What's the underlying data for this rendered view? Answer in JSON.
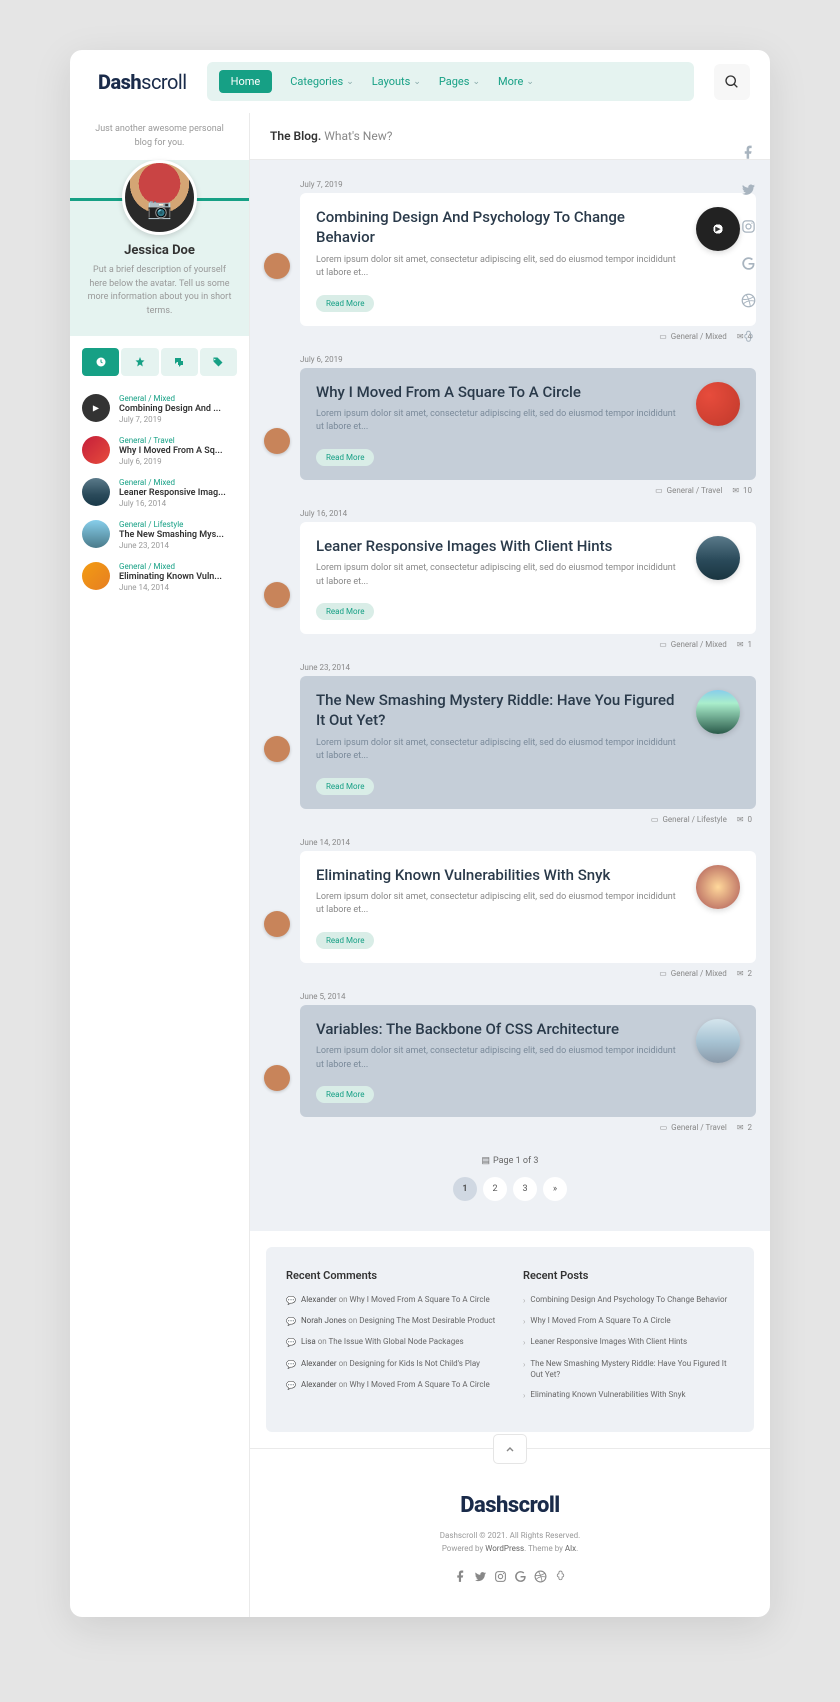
{
  "brand": {
    "strong": "Dash",
    "light": "scroll"
  },
  "nav": {
    "items": [
      {
        "label": "Home",
        "active": true
      },
      {
        "label": "Categories"
      },
      {
        "label": "Layouts"
      },
      {
        "label": "Pages"
      },
      {
        "label": "More"
      }
    ]
  },
  "profile": {
    "intro": "Just another awesome personal blog for you.",
    "name": "Jessica Doe",
    "desc": "Put a brief description of yourself here below the avatar. Tell us some more information about you in short terms."
  },
  "side_posts": [
    {
      "cat": "General / Mixed",
      "title": "Combining Design And ...",
      "date": "July 7, 2019",
      "thumb": "play"
    },
    {
      "cat": "General / Travel",
      "title": "Why I Moved From A Sq...",
      "date": "July 6, 2019",
      "thumb": "strawberry"
    },
    {
      "cat": "General / Mixed",
      "title": "Leaner Responsive Imag...",
      "date": "July 16, 2014",
      "thumb": "eyes"
    },
    {
      "cat": "General / Lifestyle",
      "title": "The New Smashing Mys...",
      "date": "June 23, 2014",
      "thumb": "lake"
    },
    {
      "cat": "General / Mixed",
      "title": "Eliminating Known Vuln...",
      "date": "June 14, 2014",
      "thumb": "warm"
    }
  ],
  "heading": {
    "label": "The Blog.",
    "sub": "What's New?"
  },
  "posts": [
    {
      "date": "July 7, 2019",
      "title": "Combining Design And Psychology To Change Behavior",
      "excerpt": "Lorem ipsum dolor sit amet, consectetur adipiscing elit, sed do eiusmod tempor incididunt ut labore et...",
      "read_more": "Read More",
      "cat": "General / Mixed",
      "comments": "4",
      "thumb": "tunnel",
      "gray": false
    },
    {
      "date": "July 6, 2019",
      "title": "Why I Moved From A Square To A Circle",
      "excerpt": "Lorem ipsum dolor sit amet, consectetur adipiscing elit, sed do eiusmod tempor incididunt ut labore et...",
      "read_more": "Read More",
      "cat": "General / Travel",
      "comments": "10",
      "thumb": "strawberry",
      "gray": true
    },
    {
      "date": "July 16, 2014",
      "title": "Leaner Responsive Images With Client Hints",
      "excerpt": "Lorem ipsum dolor sit amet, consectetur adipiscing elit, sed do eiusmod tempor incididunt ut labore et...",
      "read_more": "Read More",
      "cat": "General / Mixed",
      "comments": "1",
      "thumb": "eyes",
      "gray": false
    },
    {
      "date": "June 23, 2014",
      "title": "The New Smashing Mystery Riddle: Have You Figured It Out Yet?",
      "excerpt": "Lorem ipsum dolor sit amet, consectetur adipiscing elit, sed do eiusmod tempor incididunt ut labore et...",
      "read_more": "Read More",
      "cat": "General / Lifestyle",
      "comments": "0",
      "thumb": "lake",
      "gray": true
    },
    {
      "date": "June 14, 2014",
      "title": "Eliminating Known Vulnerabilities With Snyk",
      "excerpt": "Lorem ipsum dolor sit amet, consectetur adipiscing elit, sed do eiusmod tempor incididunt ut labore et...",
      "read_more": "Read More",
      "cat": "General / Mixed",
      "comments": "2",
      "thumb": "warm",
      "gray": false
    },
    {
      "date": "June 5, 2014",
      "title": "Variables: The Backbone Of CSS Architecture",
      "excerpt": "Lorem ipsum dolor sit amet, consectetur adipiscing elit, sed do eiusmod tempor incididunt ut labore et...",
      "read_more": "Read More",
      "cat": "General / Travel",
      "comments": "2",
      "thumb": "scenic",
      "gray": true
    }
  ],
  "pagination": {
    "info": "Page 1 of 3",
    "pages": [
      "1",
      "2",
      "3",
      "»"
    ],
    "active": 0
  },
  "widgets": {
    "comments_title": "Recent Comments",
    "posts_title": "Recent Posts",
    "comments": [
      {
        "author": "Alexander",
        "on": "on",
        "target": "Why I Moved From A Square To A Circle"
      },
      {
        "author": "Norah Jones",
        "on": "on",
        "target": "Designing The Most Desirable Product"
      },
      {
        "author": "Lisa",
        "on": "on",
        "target": "The Issue With Global Node Packages"
      },
      {
        "author": "Alexander",
        "on": "on",
        "target": "Designing for Kids Is Not Child's Play"
      },
      {
        "author": "Alexander",
        "on": "on",
        "target": "Why I Moved From A Square To A Circle"
      }
    ],
    "posts": [
      "Combining Design And Psychology To Change Behavior",
      "Why I Moved From A Square To A Circle",
      "Leaner Responsive Images With Client Hints",
      "The New Smashing Mystery Riddle: Have You Figured It Out Yet?",
      "Eliminating Known Vulnerabilities With Snyk"
    ]
  },
  "footer": {
    "copyright": "Dashscroll © 2021. All Rights Reserved.",
    "powered_pre": "Powered by ",
    "powered_link": "WordPress",
    "powered_mid": ". Theme by ",
    "powered_link2": "Alx",
    "powered_suf": "."
  }
}
